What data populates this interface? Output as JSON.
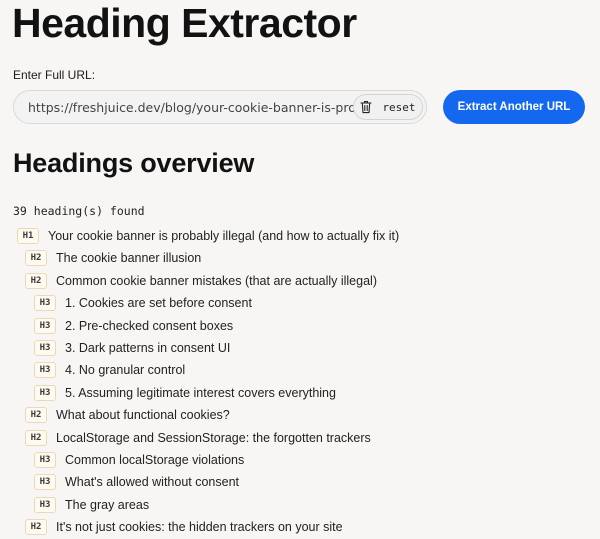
{
  "app": {
    "title": "Heading Extractor"
  },
  "form": {
    "url_label": "Enter Full URL:",
    "url_value": "https://freshjuice.dev/blog/your-cookie-banner-is-probably-illegal",
    "reset_label": "reset",
    "extract_label": "Extract Another URL"
  },
  "results": {
    "section_title": "Headings overview",
    "count_text": "39 heading(s) found",
    "headings": [
      {
        "level": "H1",
        "text": "Your cookie banner is probably illegal (and how to actually fix it)"
      },
      {
        "level": "H2",
        "text": "The cookie banner illusion"
      },
      {
        "level": "H2",
        "text": "Common cookie banner mistakes (that are actually illegal)"
      },
      {
        "level": "H3",
        "text": "1. Cookies are set before consent"
      },
      {
        "level": "H3",
        "text": "2. Pre-checked consent boxes"
      },
      {
        "level": "H3",
        "text": "3. Dark patterns in consent UI"
      },
      {
        "level": "H3",
        "text": "4. No granular control"
      },
      {
        "level": "H3",
        "text": "5. Assuming legitimate interest covers everything"
      },
      {
        "level": "H2",
        "text": "What about functional cookies?"
      },
      {
        "level": "H2",
        "text": "LocalStorage and SessionStorage: the forgotten trackers"
      },
      {
        "level": "H3",
        "text": "Common localStorage violations"
      },
      {
        "level": "H3",
        "text": "What's allowed without consent"
      },
      {
        "level": "H3",
        "text": "The gray areas"
      },
      {
        "level": "H2",
        "text": "It's not just cookies: the hidden trackers on your site"
      }
    ]
  },
  "icons": {
    "reset": "trash-icon"
  },
  "colors": {
    "accent": "#1468f0",
    "tag_border": "#ead9b8",
    "tag_bg": "#fffaf0"
  }
}
